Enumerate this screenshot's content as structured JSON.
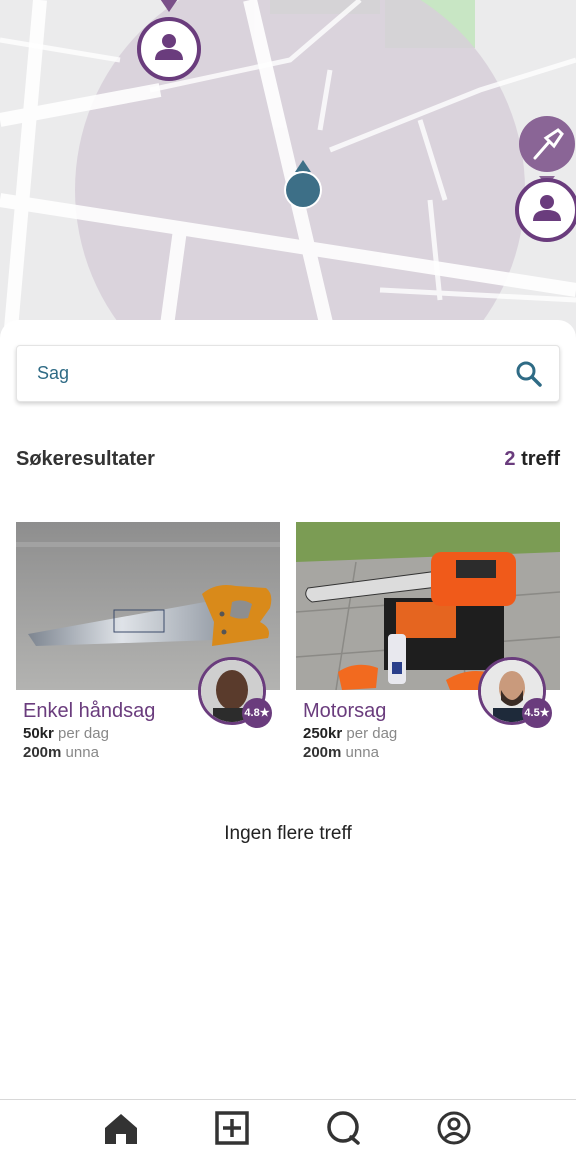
{
  "search": {
    "value": "Sag",
    "icon": "search-icon"
  },
  "results": {
    "title": "Søkeresultater",
    "count": "2",
    "count_label": "treff"
  },
  "items": [
    {
      "title": "Enkel håndsag",
      "price": "50kr",
      "price_unit": "per dag",
      "distance": "200m",
      "distance_unit": "unna",
      "rating": "4.8★"
    },
    {
      "title": "Motorsag",
      "price": "250kr",
      "price_unit": "per dag",
      "distance": "200m",
      "distance_unit": "unna",
      "rating": "4.5★"
    }
  ],
  "no_more": "Ingen flere treff",
  "nav": [
    "home-icon",
    "add-icon",
    "chat-icon",
    "profile-icon"
  ],
  "colors": {
    "accent": "#6a3c7d",
    "location": "#3d6f87"
  }
}
